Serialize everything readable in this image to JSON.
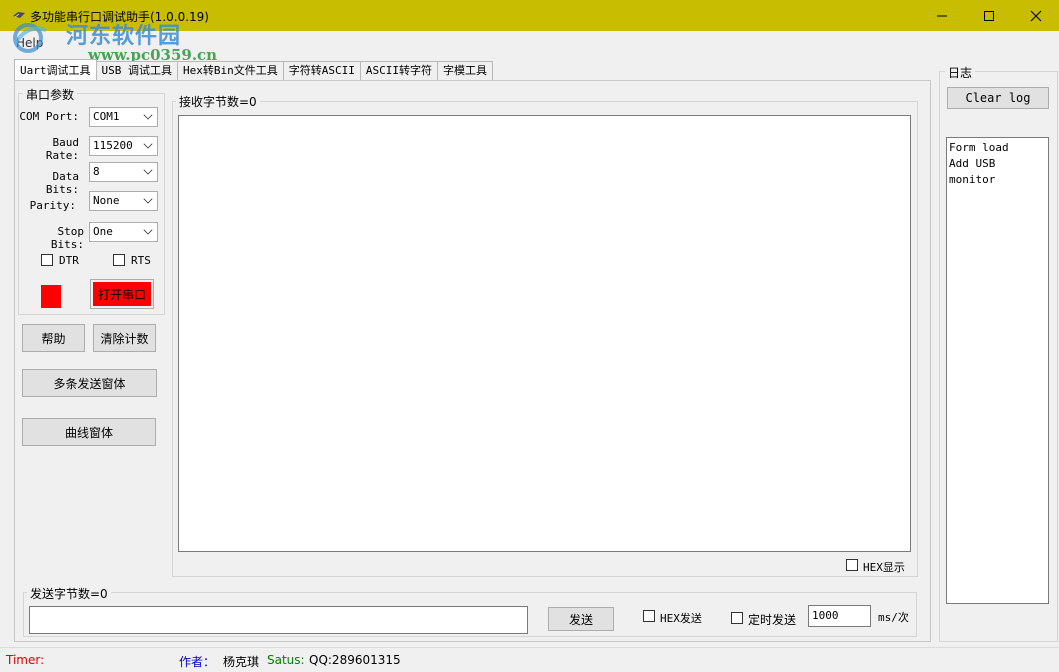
{
  "window": {
    "title": "多功能串行口调试助手(1.0.0.19)",
    "minimize_icon": "minimize-icon",
    "maximize_icon": "maximize-icon",
    "close_icon": "close-icon",
    "titlebar_color": "#c8bd00"
  },
  "menu": {
    "help": "Help"
  },
  "watermark": {
    "text": "河东软件园",
    "url": "www.pc0359.cn"
  },
  "tabs": [
    {
      "label": "Uart调试工具",
      "active": true
    },
    {
      "label": "USB 调试工具",
      "active": false
    },
    {
      "label": "Hex转Bin文件工具",
      "active": false
    },
    {
      "label": "字符转ASCII",
      "active": false
    },
    {
      "label": "ASCII转字符",
      "active": false
    },
    {
      "label": "字模工具",
      "active": false
    }
  ],
  "serial": {
    "group_title": "串口参数",
    "com_port_label": "COM Port:",
    "com_port_value": "COM1",
    "baud_label": "Baud Rate:",
    "baud_value": "115200",
    "data_bits_label": "Data Bits:",
    "data_bits_value": "8",
    "parity_label": "Parity:",
    "parity_value": "None",
    "stop_bits_label": "Stop Bits:",
    "stop_bits_value": "One",
    "dtr_label": "DTR",
    "rts_label": "RTS",
    "open_port_button": "打开串口",
    "indicator_color": "#ff0000"
  },
  "buttons": {
    "help": "帮助",
    "clear_count": "清除计数",
    "multi_send": "多条发送窗体",
    "curve": "曲线窗体"
  },
  "receive": {
    "title": "接收字节数=0",
    "hex_display": "HEX显示"
  },
  "send": {
    "title": "发送字节数=0",
    "send_button": "发送",
    "hex_send": "HEX发送",
    "timed_send": "定时发送",
    "interval_value": "1000",
    "interval_unit": "ms/次"
  },
  "log": {
    "title": "日志",
    "clear_button": "Clear log",
    "lines": [
      "Form load",
      "Add USB monitor"
    ]
  },
  "status": {
    "timer_label": "Timer:",
    "author_label": "作者：",
    "author_value": "杨克琪",
    "status_label": "Satus:",
    "status_value": "QQ:289601315",
    "timer_color": "#e00000",
    "author_color": "#0000cc",
    "status_color": "#008000"
  }
}
